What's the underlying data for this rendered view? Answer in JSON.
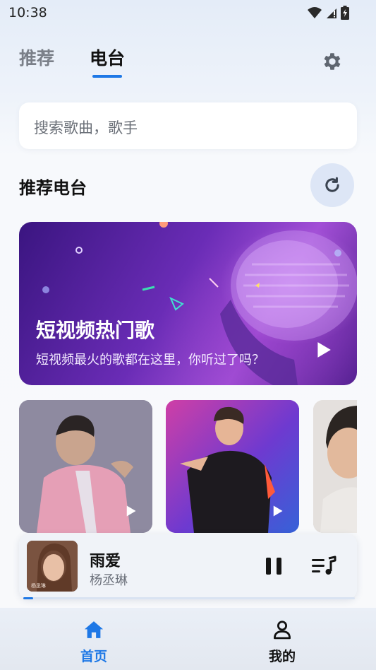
{
  "status_bar": {
    "time": "10:38",
    "icons": [
      "wifi-icon",
      "signal-icon",
      "battery-icon"
    ]
  },
  "tabs": [
    {
      "label": "推荐",
      "active": false
    },
    {
      "label": "电台",
      "active": true
    }
  ],
  "search": {
    "placeholder": "搜索歌曲，歌手"
  },
  "section": {
    "title": "推荐电台"
  },
  "banner": {
    "title": "短视频热门歌",
    "subtitle": "短视频最火的歌都在这里，你听过了吗？"
  },
  "cards": [
    {
      "name": "radio-card-1"
    },
    {
      "name": "radio-card-2"
    },
    {
      "name": "radio-card-3"
    }
  ],
  "player": {
    "title": "雨爱",
    "artist": "杨丞琳",
    "progress": 0.03
  },
  "nav": {
    "home_label": "首页",
    "me_label": "我的"
  },
  "colors": {
    "accent": "#1e78e6",
    "refresh_bg": "#dde6f6"
  }
}
